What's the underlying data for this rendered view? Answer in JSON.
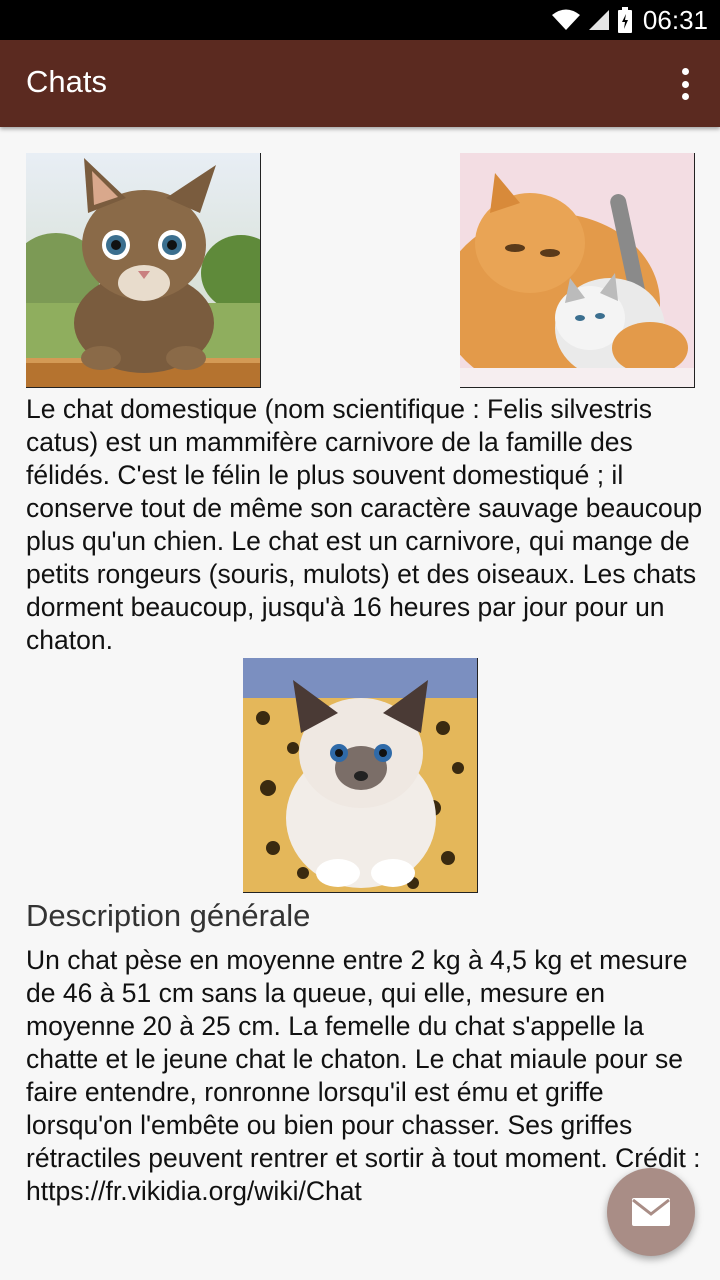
{
  "status_bar": {
    "time": "06:31",
    "icons": [
      "wifi-icon",
      "signal-icon",
      "battery-icon"
    ]
  },
  "app_bar": {
    "title": "Chats",
    "menu_icon": "more-vert-icon"
  },
  "images": [
    {
      "name": "kitten-tabby-image"
    },
    {
      "name": "cat-and-kitten-image"
    },
    {
      "name": "kitten-white-image"
    }
  ],
  "intro_text": "Le chat domestique (nom scientifique : Felis silvestris catus) est un mammifère carnivore de la famille des félidés. C'est le félin le plus souvent domestiqué ; il conserve tout de même son caractère sauvage beaucoup plus qu'un chien. Le chat est un carnivore, qui mange de petits rongeurs (souris, mulots) et des oiseaux. Les chats dorment beaucoup, jusqu'à 16 heures par jour pour un chaton.",
  "section_heading": "Description générale",
  "description_text": "Un chat pèse en moyenne entre 2 kg à 4,5 kg et mesure de 46 à 51 cm sans la queue, qui elle, mesure en moyenne 20 à 25 cm. La femelle du chat s'appelle la chatte et le jeune chat le chaton. Le chat miaule pour se faire entendre, ronronne lorsqu'il est ému et griffe lorsqu'on l'embête ou bien pour chasser. Ses griffes rétractiles peuvent rentrer et sortir à tout moment. Crédit : https://fr.vikidia.org/wiki/Chat",
  "fab": {
    "icon": "mail-icon"
  },
  "colors": {
    "app_bar": "#5b2a20",
    "fab": "#a98d86",
    "background": "#f7f7f7"
  }
}
